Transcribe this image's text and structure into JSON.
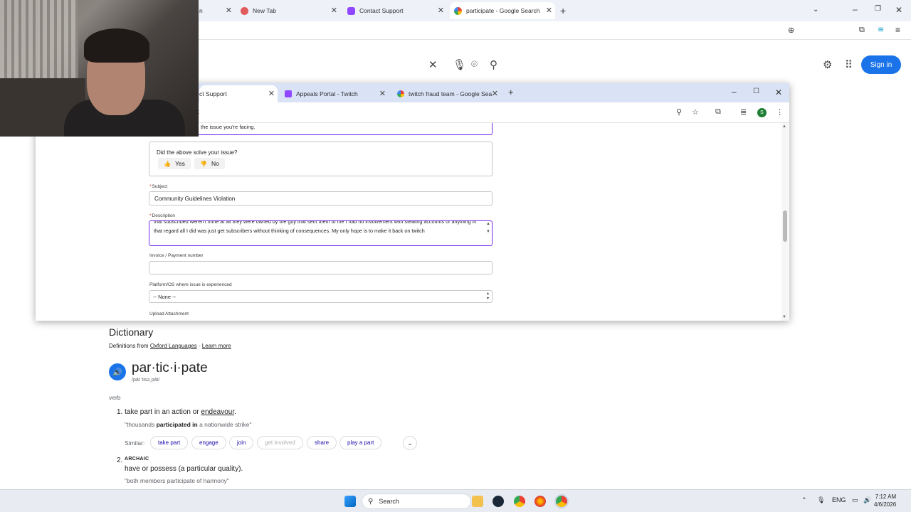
{
  "back_browser": {
    "tabs": [
      {
        "label": "n",
        "active": false
      },
      {
        "label": "New Tab",
        "active": false
      },
      {
        "label": "Contact Support",
        "active": false
      },
      {
        "label": "participate - Google Search",
        "active": true
      }
    ],
    "new_tab_symbol": "+",
    "sign_in_label": "Sign in"
  },
  "front_browser": {
    "tabs": [
      {
        "label": "ct Support",
        "active": true
      },
      {
        "label": "Appeals Portal - Twitch",
        "active": false
      },
      {
        "label": "twitch fraud team - Google Sea",
        "active": false
      }
    ],
    "address_fragment": "rt",
    "profile_initial": "S"
  },
  "form": {
    "prev_text_fragment": "the issue you're facing.",
    "solve_question": "Did the above solve your issue?",
    "yes_label": "Yes",
    "no_label": "No",
    "subject_label": "Subject",
    "subject_value": "Community Guidelines Violation",
    "description_label": "Description",
    "description_value": "that subscribed weren't mine at all they were owned by the guy that sent them to me I had no involvement with stealing accounts or anything in that regard all I did was just get subscribers without thinking of consequences. My only hope is to make it back on twitch",
    "invoice_label": "Invoice / Payment number",
    "invoice_value": "",
    "platform_label": "Platform/OS where issue is experienced",
    "platform_value": "-- None --",
    "upload_label": "Upload Attachment"
  },
  "dictionary": {
    "title": "Dictionary",
    "source_prefix": "Definitions from",
    "source_name": "Oxford Languages",
    "separator": "·",
    "learn_more": "Learn more",
    "word": "par·tic·i·pate",
    "phonetic": "/pärˈtisəˌpāt/",
    "part_of_speech": "verb",
    "definitions": [
      {
        "num": "1.",
        "text_before": "take part in an action or ",
        "link": "endeavour",
        "text_after": ".",
        "example_open": "\"thousands ",
        "example_bold": "participated in",
        "example_close": " a nationwide strike\""
      },
      {
        "num": "2.",
        "register": "ARCHAIC",
        "text": "have or possess (a particular quality).",
        "example": "\"both members participate of harmony\""
      }
    ],
    "similar_label": "Similar:",
    "similar": [
      "take part",
      "engage",
      "join",
      "get involved",
      "share",
      "play a part"
    ]
  },
  "taskbar": {
    "search_label": "Search",
    "language": "ENG",
    "time": "7:12 AM",
    "date": "4/6/2026"
  },
  "colors": {
    "accent_blue": "#1a73e8",
    "twitch_purple": "#9147ff",
    "focus_border": "#772ce8",
    "required_star": "#e91916"
  }
}
